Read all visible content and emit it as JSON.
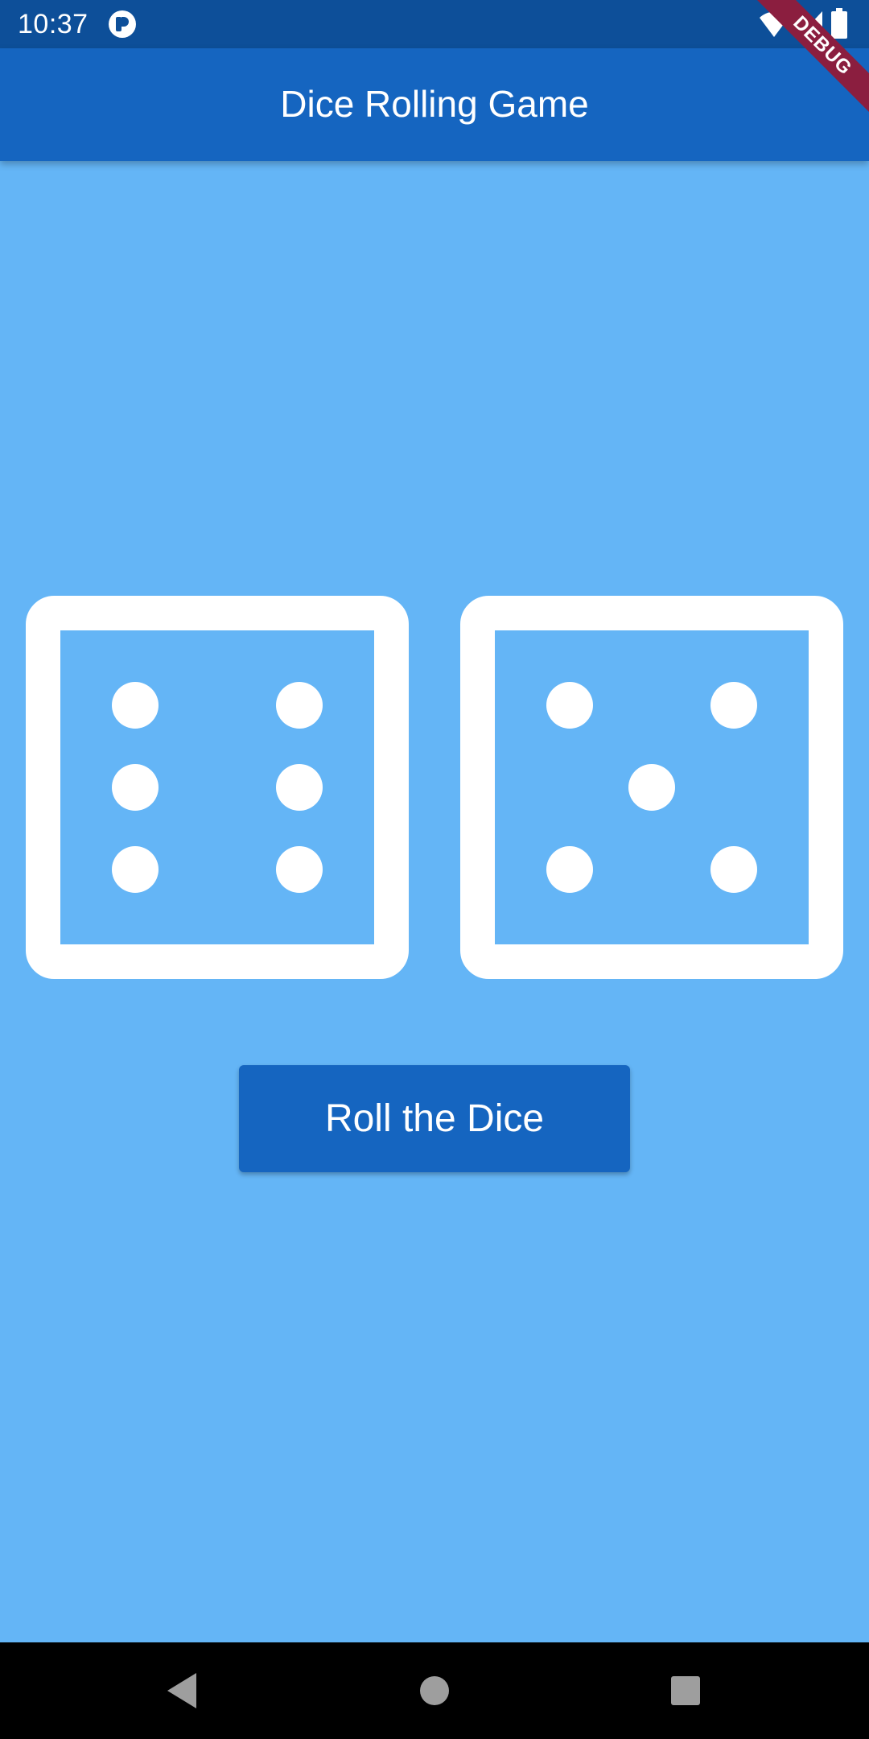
{
  "status_bar": {
    "time": "10:37",
    "icons": [
      "app-notification-icon",
      "wifi-icon",
      "cell-signal-icon",
      "battery-icon"
    ]
  },
  "debug_banner": {
    "label": "DEBUG"
  },
  "app_bar": {
    "title": "Dice Rolling Game"
  },
  "dice": [
    {
      "name": "left-die",
      "value": 6
    },
    {
      "name": "right-die",
      "value": 5
    }
  ],
  "roll_button": {
    "label": "Roll the Dice"
  },
  "nav_bar": {
    "icons": [
      "back-icon",
      "home-icon",
      "recents-icon"
    ]
  },
  "colors": {
    "background": "#64B5F6",
    "app_bar": "#1565C0",
    "status_bar": "#0D4F99",
    "button": "#1565C0",
    "dice": "#FFFFFF",
    "debug_ribbon": "#8B1E3F"
  }
}
